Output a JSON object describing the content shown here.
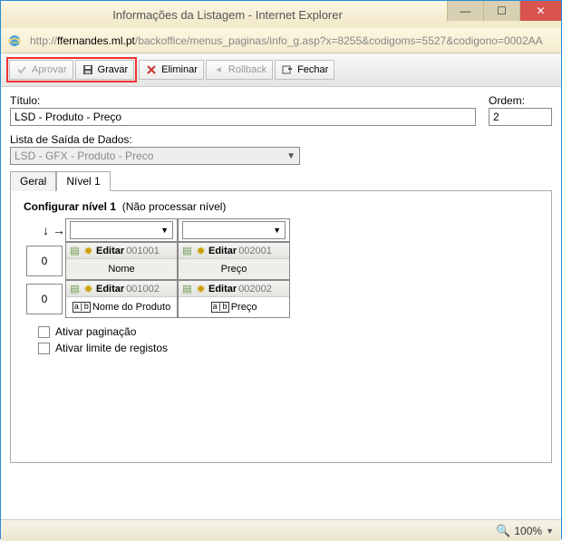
{
  "window": {
    "title": "Informações da Listagem - Internet Explorer"
  },
  "url": {
    "scheme": "http://",
    "host": "ffernandes.ml.pt",
    "path": "/backoffice/menus_paginas/info_g.asp?x=8255&codigoms=5527&codigono=0002AA"
  },
  "toolbar": {
    "aprovar": "Aprovar",
    "gravar": "Gravar",
    "eliminar": "Eliminar",
    "rollback": "Rollback",
    "fechar": "Fechar"
  },
  "form": {
    "titulo_label": "Título:",
    "titulo_value": "LSD - Produto - Preço",
    "ordem_label": "Ordem:",
    "ordem_value": "2",
    "lista_label": "Lista de Saída de Dados:",
    "lista_value": "LSD - GFX - Produto - Preco"
  },
  "tabs": {
    "geral": "Geral",
    "nivel1": "Nível 1"
  },
  "config": {
    "title_bold": "Configurar nível 1",
    "title_rest": "(Não processar nível)",
    "row_value_1": "0",
    "row_value_2": "0",
    "edit_label": "Editar",
    "cols": [
      {
        "id1": "001001",
        "name": "Nome",
        "id2": "001002",
        "field": "Nome do Produto"
      },
      {
        "id1": "002001",
        "name": "Preço",
        "id2": "002002",
        "field": "Preço"
      }
    ],
    "chk_paginacao": "Ativar paginação",
    "chk_limite": "Ativar limite de registos"
  },
  "status": {
    "zoom": "100%"
  }
}
